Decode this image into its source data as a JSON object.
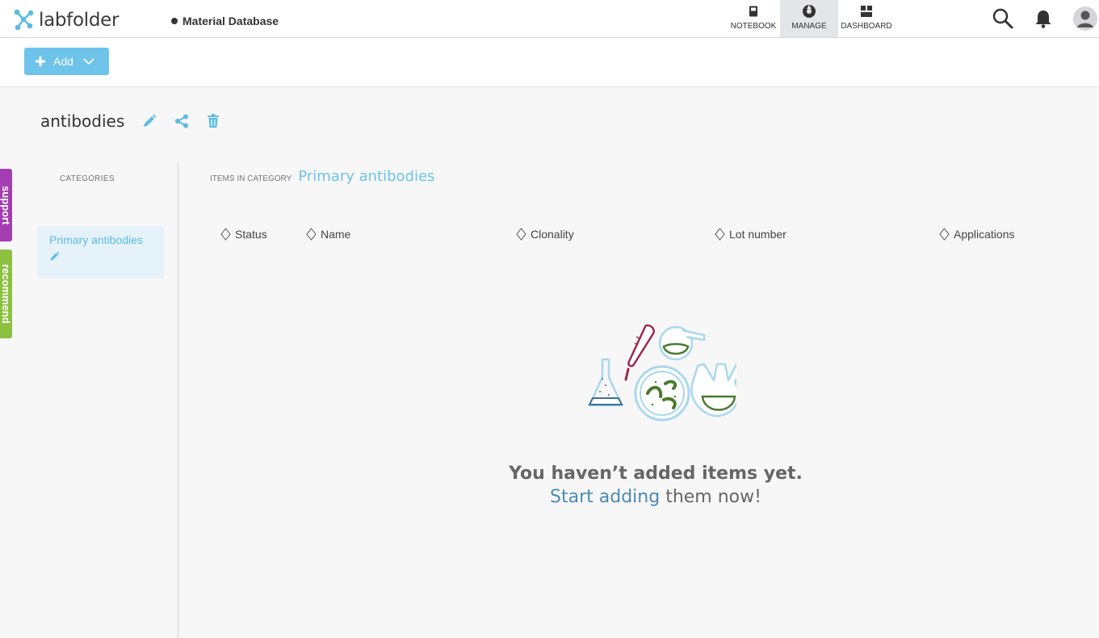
{
  "app": {
    "name": "labfolder",
    "section": "Material Database"
  },
  "nav": [
    {
      "label": "NOTEBOOK",
      "icon": "notebook-icon",
      "active": false
    },
    {
      "label": "MANAGE",
      "icon": "manage-icon",
      "active": true
    },
    {
      "label": "DASHBOARD",
      "icon": "dashboard-icon",
      "active": false
    }
  ],
  "toolbar": {
    "add_label": "Add"
  },
  "page": {
    "title": "antibodies"
  },
  "side_tabs": {
    "support": "support",
    "recommend": "recommend"
  },
  "categories": {
    "heading": "CATEGORIES",
    "items": [
      {
        "label": "Primary antibodies",
        "selected": true
      }
    ]
  },
  "items": {
    "heading": "ITEMS IN CATEGORY",
    "category": "Primary antibodies",
    "columns": [
      "Status",
      "Name",
      "Clonality",
      "Lot number",
      "Applications"
    ]
  },
  "empty_state": {
    "title": "You haven’t added items yet.",
    "link": "Start adding",
    "rest": " them now!"
  },
  "colors": {
    "accent": "#6ec3ea",
    "support": "#a33db1",
    "recommend": "#8cc13f"
  }
}
